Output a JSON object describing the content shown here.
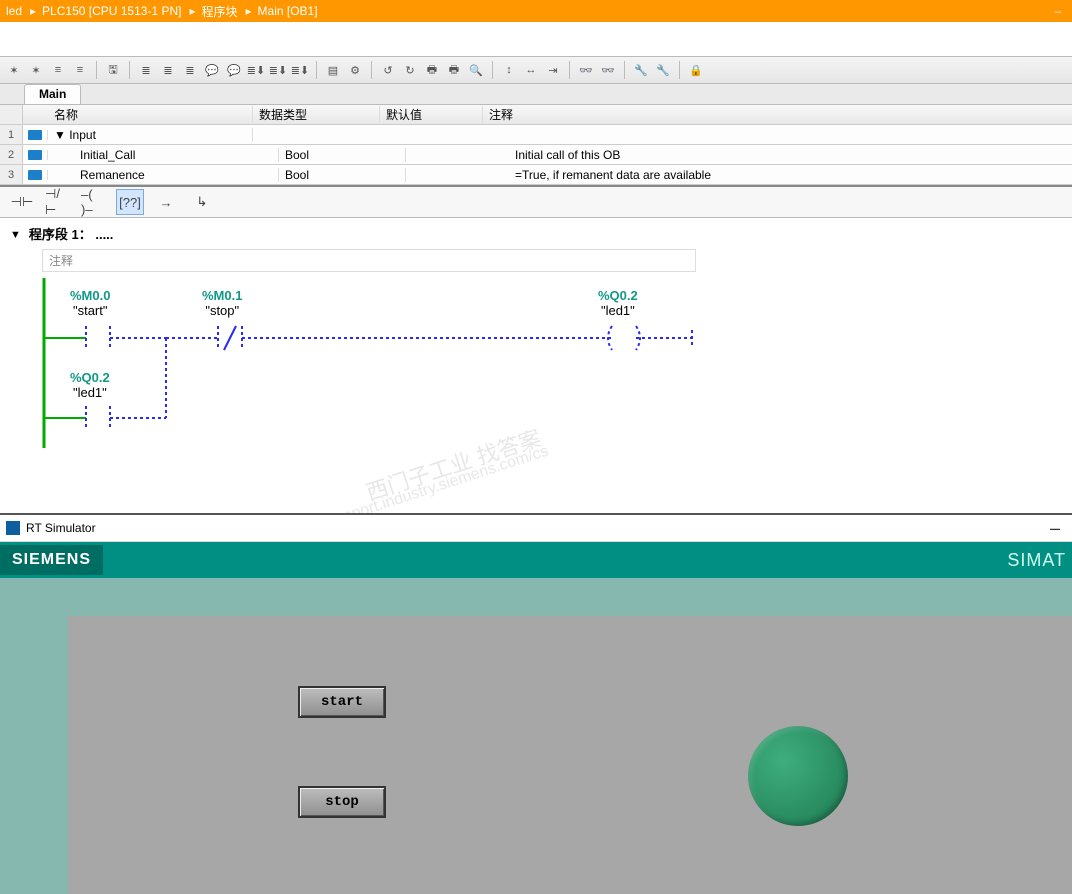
{
  "breadcrumb": {
    "b0": "led",
    "b1": "PLC150 [CPU 1513-1 PN]",
    "b2": "程序块",
    "b3": "Main [OB1]"
  },
  "tabs": {
    "main": "Main"
  },
  "varTable": {
    "head": {
      "name": "名称",
      "type": "数据类型",
      "def": "默认值",
      "com": "注释"
    },
    "rows": [
      {
        "num": "1",
        "name": "Input",
        "type": "",
        "def": "",
        "com": ""
      },
      {
        "num": "2",
        "name": "Initial_Call",
        "type": "Bool",
        "def": "",
        "com": "Initial call of this OB"
      },
      {
        "num": "3",
        "name": "Remanence",
        "type": "Bool",
        "def": "",
        "com": "=True, if remanent data are available"
      }
    ]
  },
  "network": {
    "title": "程序段 1：  .....",
    "comment": "注释"
  },
  "ladder": {
    "start": {
      "addr": "%M0.0",
      "name": "\"start\""
    },
    "stop": {
      "addr": "%M0.1",
      "name": "\"stop\""
    },
    "out": {
      "addr": "%Q0.2",
      "name": "\"led1\""
    },
    "branch": {
      "addr": "%Q0.2",
      "name": "\"led1\""
    }
  },
  "lbtns": [
    "⊣⊢",
    "⊣/⊢",
    "–( )–",
    "[??]",
    "→",
    "↳"
  ],
  "sim": {
    "title": "RT Simulator",
    "brandL": "SIEMENS",
    "brandR": "SIMAT",
    "btnStart": "start",
    "btnStop": "stop"
  },
  "wm": {
    "a": "西门子工业 找答案",
    "b": "support.industry.siemens.com/cs"
  }
}
